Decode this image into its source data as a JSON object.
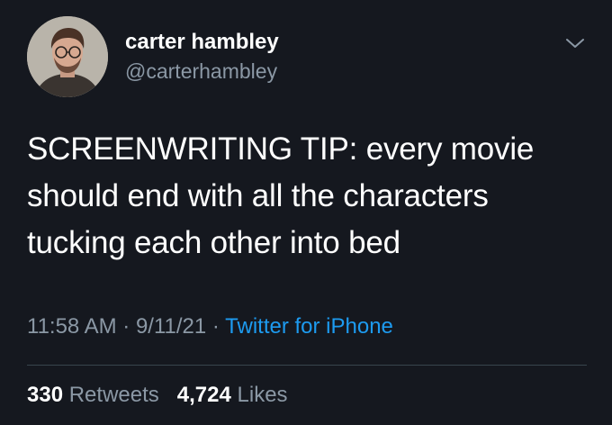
{
  "author": {
    "display_name": "carter hambley",
    "handle": "@carterhambley",
    "avatar_icon": "user-avatar"
  },
  "tweet": {
    "lines": [
      "SCREENWRITING TIP: every movie",
      "should end with all the characters",
      "tucking each other into bed"
    ]
  },
  "meta": {
    "time": "11:58 AM",
    "sep1": " · ",
    "date": "9/11/21",
    "sep2": " · ",
    "source": "Twitter for iPhone"
  },
  "stats": {
    "retweets_count": "330",
    "retweets_label": "Retweets",
    "likes_count": "4,724",
    "likes_label": "Likes"
  },
  "colors": {
    "background": "#15181f",
    "secondary_text": "#8b98a5",
    "link": "#1d9bf0",
    "divider": "#38444d"
  },
  "icons": {
    "menu": "chevron-down-icon"
  }
}
